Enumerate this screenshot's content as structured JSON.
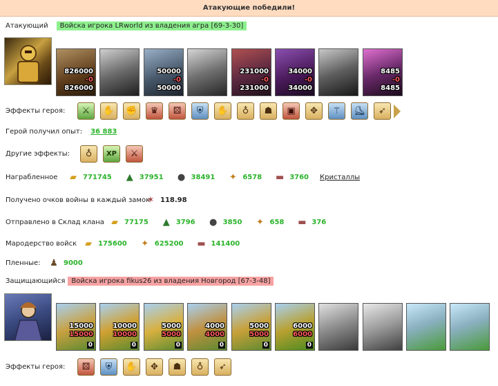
{
  "banner": "Атакующие победили!",
  "attacker": {
    "label": "Атакующий",
    "name": "Войска игрока LRworld из владения агра [69-3-30]",
    "units": [
      {
        "top": "826000",
        "loss": "-0",
        "bottom": "826000"
      },
      {
        "top": "",
        "loss": "",
        "bottom": ""
      },
      {
        "top": "50000",
        "loss": "-0",
        "bottom": "50000"
      },
      {
        "top": "",
        "loss": "",
        "bottom": ""
      },
      {
        "top": "231000",
        "loss": "-0",
        "bottom": "231000"
      },
      {
        "top": "34000",
        "loss": "-0",
        "bottom": "34000"
      },
      {
        "top": "",
        "loss": "",
        "bottom": ""
      },
      {
        "top": "8485",
        "loss": "-0",
        "bottom": "8485"
      }
    ]
  },
  "hero_effects_label": "Эффекты героя:",
  "hero_exp": {
    "label": "Герой получил опыт:",
    "value": "36 883"
  },
  "other_effects_label": "Другие эффекты:",
  "loot": {
    "label": "Награбленное",
    "items": [
      {
        "icon": "gold-icon",
        "value": "771745"
      },
      {
        "icon": "wood-icon",
        "value": "37951"
      },
      {
        "icon": "ore-icon",
        "value": "38491"
      },
      {
        "icon": "grain-icon",
        "value": "6578"
      },
      {
        "icon": "stone-icon",
        "value": "3760"
      }
    ],
    "crystals": "Кристаллы"
  },
  "war_points": {
    "label": "Получено очков войны в каждый замок",
    "value": "118.98"
  },
  "clan_store": {
    "label": "Отправлено в Склад клана",
    "items": [
      {
        "icon": "gold-icon",
        "value": "77175"
      },
      {
        "icon": "wood-icon",
        "value": "3796"
      },
      {
        "icon": "ore-icon",
        "value": "3850"
      },
      {
        "icon": "grain-icon",
        "value": "658"
      },
      {
        "icon": "stone-icon",
        "value": "376"
      }
    ]
  },
  "marauding": {
    "label": "Мародерство войск",
    "items": [
      {
        "icon": "gold-icon",
        "value": "175600"
      },
      {
        "icon": "grain-icon",
        "value": "625200"
      },
      {
        "icon": "stone-icon",
        "value": "141400"
      }
    ]
  },
  "prisoners": {
    "label": "Пленные:",
    "value": "9000"
  },
  "defender": {
    "label": "Защищающийся",
    "name": "Войска игрока fikus26 из владения Новгород [67-3-48]",
    "units": [
      {
        "top": "15000",
        "loss": "15000",
        "bottom": "0"
      },
      {
        "top": "10000",
        "loss": "10000",
        "bottom": "0"
      },
      {
        "top": "5000",
        "loss": "5000",
        "bottom": "0"
      },
      {
        "top": "4000",
        "loss": "4000",
        "bottom": "0"
      },
      {
        "top": "5000",
        "loss": "5000",
        "bottom": "0"
      },
      {
        "top": "6000",
        "loss": "6000",
        "bottom": "0"
      },
      {
        "top": "",
        "loss": "",
        "bottom": ""
      },
      {
        "top": "",
        "loss": "",
        "bottom": ""
      },
      {
        "top": "",
        "loss": "",
        "bottom": ""
      },
      {
        "top": "",
        "loss": "",
        "bottom": ""
      }
    ]
  },
  "defender_effects_label": "Эффекты героя:"
}
